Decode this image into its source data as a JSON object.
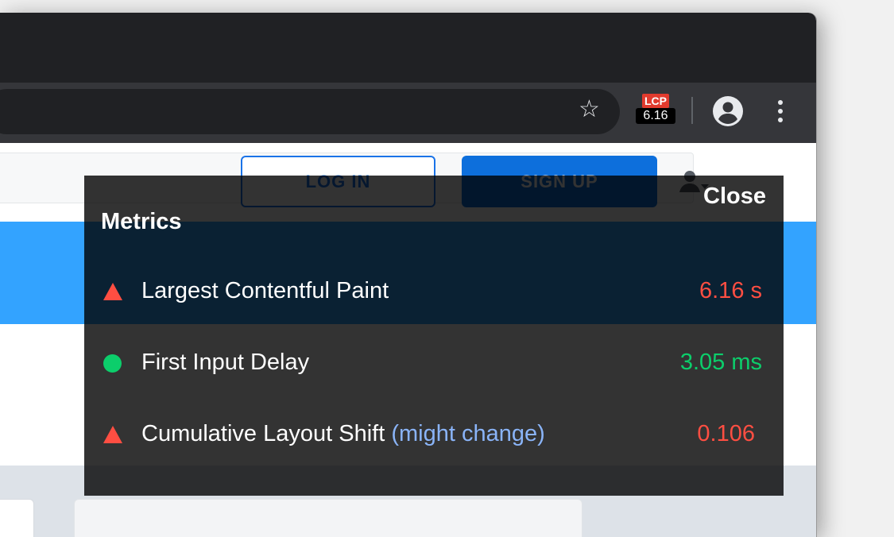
{
  "browser": {
    "extension_badge": {
      "label": "LCP",
      "value": "6.16"
    },
    "icons": {
      "bookmark": "star-icon",
      "profile": "account-circle-icon",
      "menu": "more-vert-icon"
    }
  },
  "page": {
    "login_label": "LOG IN",
    "signup_label": "SIGN UP"
  },
  "overlay": {
    "close_label": "Close",
    "heading": "Metrics",
    "metrics": [
      {
        "name": "Largest Contentful Paint",
        "note": "",
        "value": "6.16 s",
        "status": "poor",
        "color": "#ff4e42"
      },
      {
        "name": "First Input Delay",
        "note": "",
        "value": "3.05 ms",
        "status": "good",
        "color": "#0cce6b"
      },
      {
        "name": "Cumulative Layout Shift",
        "note": "(might change)",
        "value": "0.106",
        "status": "poor",
        "color": "#ff4e42"
      }
    ]
  },
  "colors": {
    "poor": "#ff4e42",
    "good": "#0cce6b",
    "accent_blue": "#1a73e8",
    "note_blue": "#8ab4f8"
  }
}
